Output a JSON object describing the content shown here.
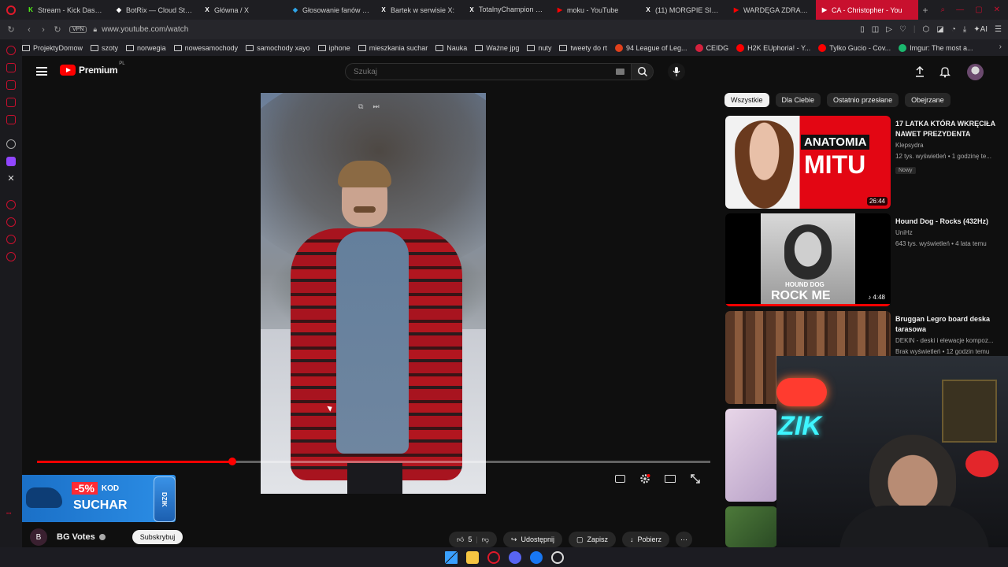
{
  "browser": {
    "tabs": [
      {
        "label": "Stream - Kick Dashbo",
        "fav": "K",
        "fav_color": "#53fc18"
      },
      {
        "label": "BotRix — Cloud Strea",
        "fav": "◆",
        "fav_color": "#ffffff"
      },
      {
        "label": "Główna / X",
        "fav": "X",
        "fav_color": "#ffffff"
      },
      {
        "label": "Głosowanie fanów na",
        "fav": "◆",
        "fav_color": "#2fa4e7"
      },
      {
        "label": "Bartek w serwisie X:",
        "fav": "X",
        "fav_color": "#ffffff"
      },
      {
        "label": "TotalnyChampion 🤩👑",
        "fav": "X",
        "fav_color": "#ffffff"
      },
      {
        "label": "moku - YouTube",
        "fav": "▶",
        "fav_color": "#ff0000"
      },
      {
        "label": "(11) MORGPIE SIMP w",
        "fav": "X",
        "fav_color": "#ffffff"
      },
      {
        "label": "WARDĘGA ZDRADZA",
        "fav": "▶",
        "fav_color": "#ff0000"
      },
      {
        "label": "CA - Christopher - You",
        "fav": "▶",
        "fav_color": "#ffffff",
        "active": true
      }
    ],
    "new_tab": "+",
    "vpn": "VPN",
    "url": "www.youtube.com/watch",
    "ai_label": "AI",
    "bookmarks": [
      {
        "label": "ProjektyDomow",
        "type": "folder"
      },
      {
        "label": "szoty",
        "type": "folder"
      },
      {
        "label": "norwegia",
        "type": "folder"
      },
      {
        "label": "nowesamochody",
        "type": "folder"
      },
      {
        "label": "samochody xayo",
        "type": "folder"
      },
      {
        "label": "iphone",
        "type": "folder"
      },
      {
        "label": "mieszkania suchar",
        "type": "folder"
      },
      {
        "label": "Nauka",
        "type": "folder"
      },
      {
        "label": "Ważne jpg",
        "type": "folder"
      },
      {
        "label": "nuty",
        "type": "folder"
      },
      {
        "label": "tweety do rt",
        "type": "folder"
      },
      {
        "label": "94 League of Leg...",
        "type": "site",
        "color": "#e0401b"
      },
      {
        "label": "CEIDG",
        "type": "site",
        "color": "#d4213d"
      },
      {
        "label": "H2K EUphoria! - Y...",
        "type": "site",
        "color": "#ff0000"
      },
      {
        "label": "Tylko Gucio - Cov...",
        "type": "site",
        "color": "#ff0000"
      },
      {
        "label": "Imgur: The most a...",
        "type": "site",
        "color": "#1bb76e"
      }
    ]
  },
  "youtube": {
    "logo_text": "Premium",
    "logo_region": "PL",
    "search_placeholder": "Szukaj",
    "progress_fraction": 0.29,
    "channel": {
      "avatar_letter": "B",
      "name": "BG Votes",
      "subscribe": "Subskrybuj"
    },
    "actions": {
      "likes": "5",
      "share": "Udostępnij",
      "save": "Zapisz",
      "download": "Pobierz"
    },
    "ad": {
      "discount": "-5%",
      "code_word": "KOD",
      "code": "SUCHAR",
      "brand": "DZIK"
    },
    "chips": [
      "Wszystkie",
      "Dla Ciebie",
      "Ostatnio przesłane",
      "Obejrzane"
    ],
    "recommendations": [
      {
        "title": "17 LATKA KTÓRA WKRĘCIŁA NAWET PREZYDENTA",
        "channel": "Klepsydra",
        "meta": "12 tys. wyświetleń • 1 godzinę te...",
        "badge": "Nowy",
        "duration": "26:44",
        "thumb_text_1": "ANATOMIA",
        "thumb_text_2": "MITU"
      },
      {
        "title": "Hound Dog - Rocks (432Hz)",
        "channel": "UniHz",
        "meta": "643 tys. wyświetleń • 4 lata temu",
        "badge": "",
        "duration": "♪ 4:48",
        "thumb_text_1": "HOUND DOG",
        "thumb_text_2": "ROCK ME"
      },
      {
        "title": "Bruggan Legro board deska tarasowa",
        "channel": "DEKIN - deski i elewacje kompoz...",
        "meta": "Brak wyświetleń • 12 godzin temu",
        "badge": "",
        "duration": "",
        "thumb_text_1": "",
        "thumb_text_2": ""
      }
    ]
  },
  "webcam": {
    "neon_text": "ZIK"
  },
  "colors": {
    "accent": "#ff0000",
    "opera_red": "#c8102e",
    "bg": "#0f0f0f"
  }
}
